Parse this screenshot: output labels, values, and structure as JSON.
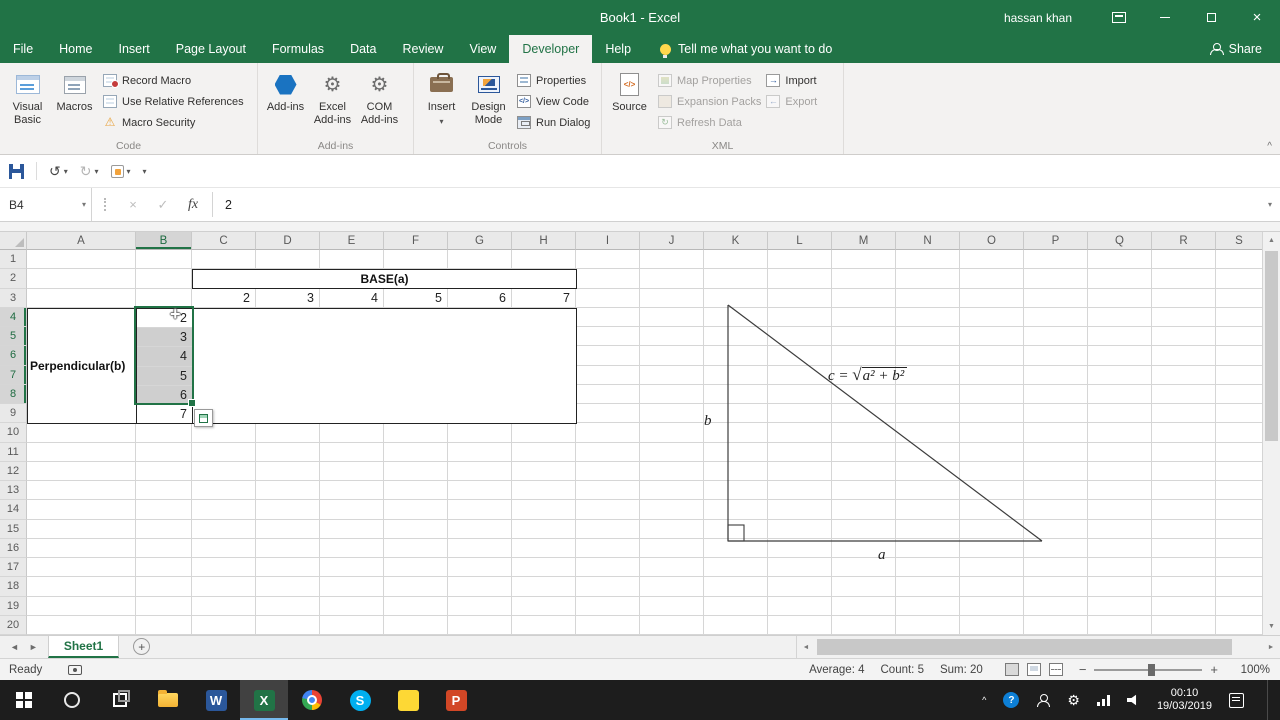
{
  "title_bar": {
    "title": "Book1 - Excel",
    "user": "hassan khan"
  },
  "ribbon_tabs": [
    {
      "label": "File"
    },
    {
      "label": "Home"
    },
    {
      "label": "Insert"
    },
    {
      "label": "Page Layout"
    },
    {
      "label": "Formulas"
    },
    {
      "label": "Data"
    },
    {
      "label": "Review"
    },
    {
      "label": "View"
    },
    {
      "label": "Developer"
    },
    {
      "label": "Help"
    }
  ],
  "search": {
    "tell_me": "Tell me what you want to do"
  },
  "share": {
    "label": "Share"
  },
  "ribbon": {
    "code": {
      "label": "Code",
      "visual_basic": "Visual Basic",
      "macros": "Macros",
      "record_macro": "Record Macro",
      "use_relative_references": "Use Relative References",
      "macro_security": "Macro Security"
    },
    "addins": {
      "label": "Add-ins",
      "add_ins": "Add-ins",
      "excel_add_ins": "Excel Add-ins",
      "com_add_ins": "COM Add-ins"
    },
    "controls": {
      "label": "Controls",
      "insert": "Insert",
      "design_mode": "Design Mode",
      "properties": "Properties",
      "view_code": "View Code",
      "run_dialog": "Run Dialog"
    },
    "xml": {
      "label": "XML",
      "source": "Source",
      "map_properties": "Map Properties",
      "expansion_packs": "Expansion Packs",
      "refresh_data": "Refresh Data",
      "import": "Import",
      "export": "Export"
    }
  },
  "formula_bar": {
    "name_box": "B4",
    "fx": "fx",
    "value": "2"
  },
  "grid": {
    "column_headers": [
      "A",
      "B",
      "C",
      "D",
      "E",
      "F",
      "G",
      "H",
      "I",
      "J",
      "K",
      "L",
      "M",
      "N",
      "O",
      "P",
      "Q",
      "R",
      "S"
    ],
    "row_headers": [
      "1",
      "2",
      "3",
      "4",
      "5",
      "6",
      "7",
      "8",
      "9",
      "10",
      "11",
      "12",
      "13",
      "14",
      "15",
      "16",
      "17",
      "18",
      "19",
      "20"
    ],
    "selected_column": "B",
    "selected_rows": [
      "4",
      "5",
      "6",
      "7",
      "8"
    ]
  },
  "table": {
    "base_header": "BASE(a)",
    "base_values": [
      "2",
      "3",
      "4",
      "5",
      "6",
      "7"
    ],
    "perpendicular_header": "Perpendicular(b)",
    "perpendicular_values": [
      "2",
      "3",
      "4",
      "5",
      "6",
      "7"
    ]
  },
  "figure": {
    "side_b": "b",
    "side_a": "a",
    "formula_prefix": "c = ",
    "formula_sqrt": "√",
    "formula_radicand": "a² + b²"
  },
  "sheet_bar": {
    "active_sheet": "Sheet1"
  },
  "status_bar": {
    "mode": "Ready",
    "average": "Average: 4",
    "count": "Count: 5",
    "sum": "Sum: 20",
    "zoom_level": "100%"
  },
  "taskbar": {
    "clock_time": "00:10",
    "clock_date": "19/03/2019",
    "apps": {
      "word": "W",
      "excel": "X",
      "skype": "S",
      "powerpoint": "P"
    }
  },
  "glyphs": {
    "dropdown": "▾",
    "undo": "↺",
    "redo": "↻",
    "cancel": "×",
    "enter": "✓",
    "warning": "⚠",
    "gear": "⚙",
    "left": "◄",
    "right": "►",
    "up": "▲",
    "down": "▼",
    "plus": "+",
    "minus": "−",
    "chevron_up": "^",
    "question": "?",
    "cursor": "+",
    "code_tags": "</>",
    "refresh": "↻",
    "import_arrow": "→",
    "export_arrow": "←"
  }
}
